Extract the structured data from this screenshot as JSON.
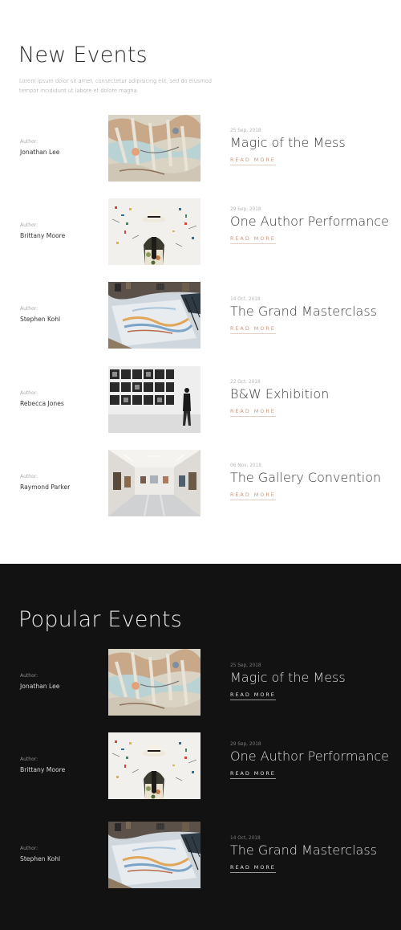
{
  "new_events": {
    "title": "New Events",
    "description": "Lorem ipsum dolor sit amet, consectetur adipisicing elit, sed do eiusmod tempor incididunt ut labore et dolore magna.",
    "items": [
      {
        "author_label": "Author:",
        "author": "Jonathan Lee",
        "date": "25 Sep, 2018",
        "title": "Magic of the Mess",
        "read_more": "READ MORE",
        "image": "abstract-paint-image"
      },
      {
        "author_label": "Author:",
        "author": "Brittany Moore",
        "date": "29 Sep, 2018",
        "title": "One Author Performance",
        "read_more": "READ MORE",
        "image": "woman-in-hat-image"
      },
      {
        "author_label": "Author:",
        "author": "Stephen Kohl",
        "date": "14 Oct, 2018",
        "title": "The Grand Masterclass",
        "read_more": "READ MORE",
        "image": "painting-desk-image"
      },
      {
        "author_label": "Author:",
        "author": "Rebecca Jones",
        "date": "22 Oct, 2018",
        "title": "B&W Exhibition",
        "read_more": "READ MORE",
        "image": "bw-gallery-image"
      },
      {
        "author_label": "Author:",
        "author": "Raymond Parker",
        "date": "06 Nov, 2018",
        "title": "The Gallery Convention",
        "read_more": "READ MORE",
        "image": "gallery-hall-image"
      }
    ]
  },
  "popular_events": {
    "title": "Popular Events",
    "items": [
      {
        "author_label": "Author:",
        "author": "Jonathan Lee",
        "date": "25 Sep, 2018",
        "title": "Magic of the Mess",
        "read_more": "READ MORE",
        "image": "abstract-paint-image"
      },
      {
        "author_label": "Author:",
        "author": "Brittany Moore",
        "date": "29 Sep, 2018",
        "title": "One Author Performance",
        "read_more": "READ MORE",
        "image": "woman-in-hat-image"
      },
      {
        "author_label": "Author:",
        "author": "Stephen Kohl",
        "date": "14 Oct, 2018",
        "title": "The Grand Masterclass",
        "read_more": "READ MORE",
        "image": "painting-desk-image"
      }
    ]
  },
  "colors": {
    "accent": "#c79a82",
    "dark_background": "#121212",
    "light_background": "#ffffff"
  }
}
